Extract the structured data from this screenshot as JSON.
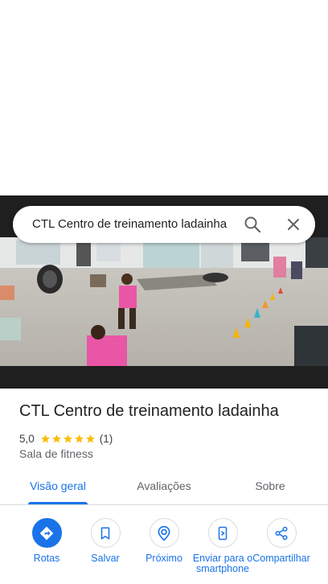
{
  "search": {
    "query": "CTL Centro de treinamento ladainha",
    "search_icon": "search-icon",
    "close_icon": "close-icon"
  },
  "place": {
    "title": "CTL Centro de treinamento ladainha",
    "rating": "5,0",
    "rating_stars": 5,
    "review_count": "(1)",
    "category": "Sala de fitness"
  },
  "tabs": [
    {
      "label": "Visão geral",
      "active": true
    },
    {
      "label": "Avaliações",
      "active": false
    },
    {
      "label": "Sobre",
      "active": false
    }
  ],
  "actions": [
    {
      "label": "Rotas",
      "icon": "directions-icon"
    },
    {
      "label": "Salvar",
      "icon": "bookmark-icon"
    },
    {
      "label": "Próximo",
      "icon": "nearby-icon"
    },
    {
      "label": "Enviar para o smartphone",
      "icon": "send-to-phone-icon"
    },
    {
      "label": "Compartilhar",
      "icon": "share-icon"
    }
  ],
  "colors": {
    "accent": "#1a73e8",
    "star": "#fbbc04",
    "text": "#202124",
    "muted": "#5f6368"
  }
}
